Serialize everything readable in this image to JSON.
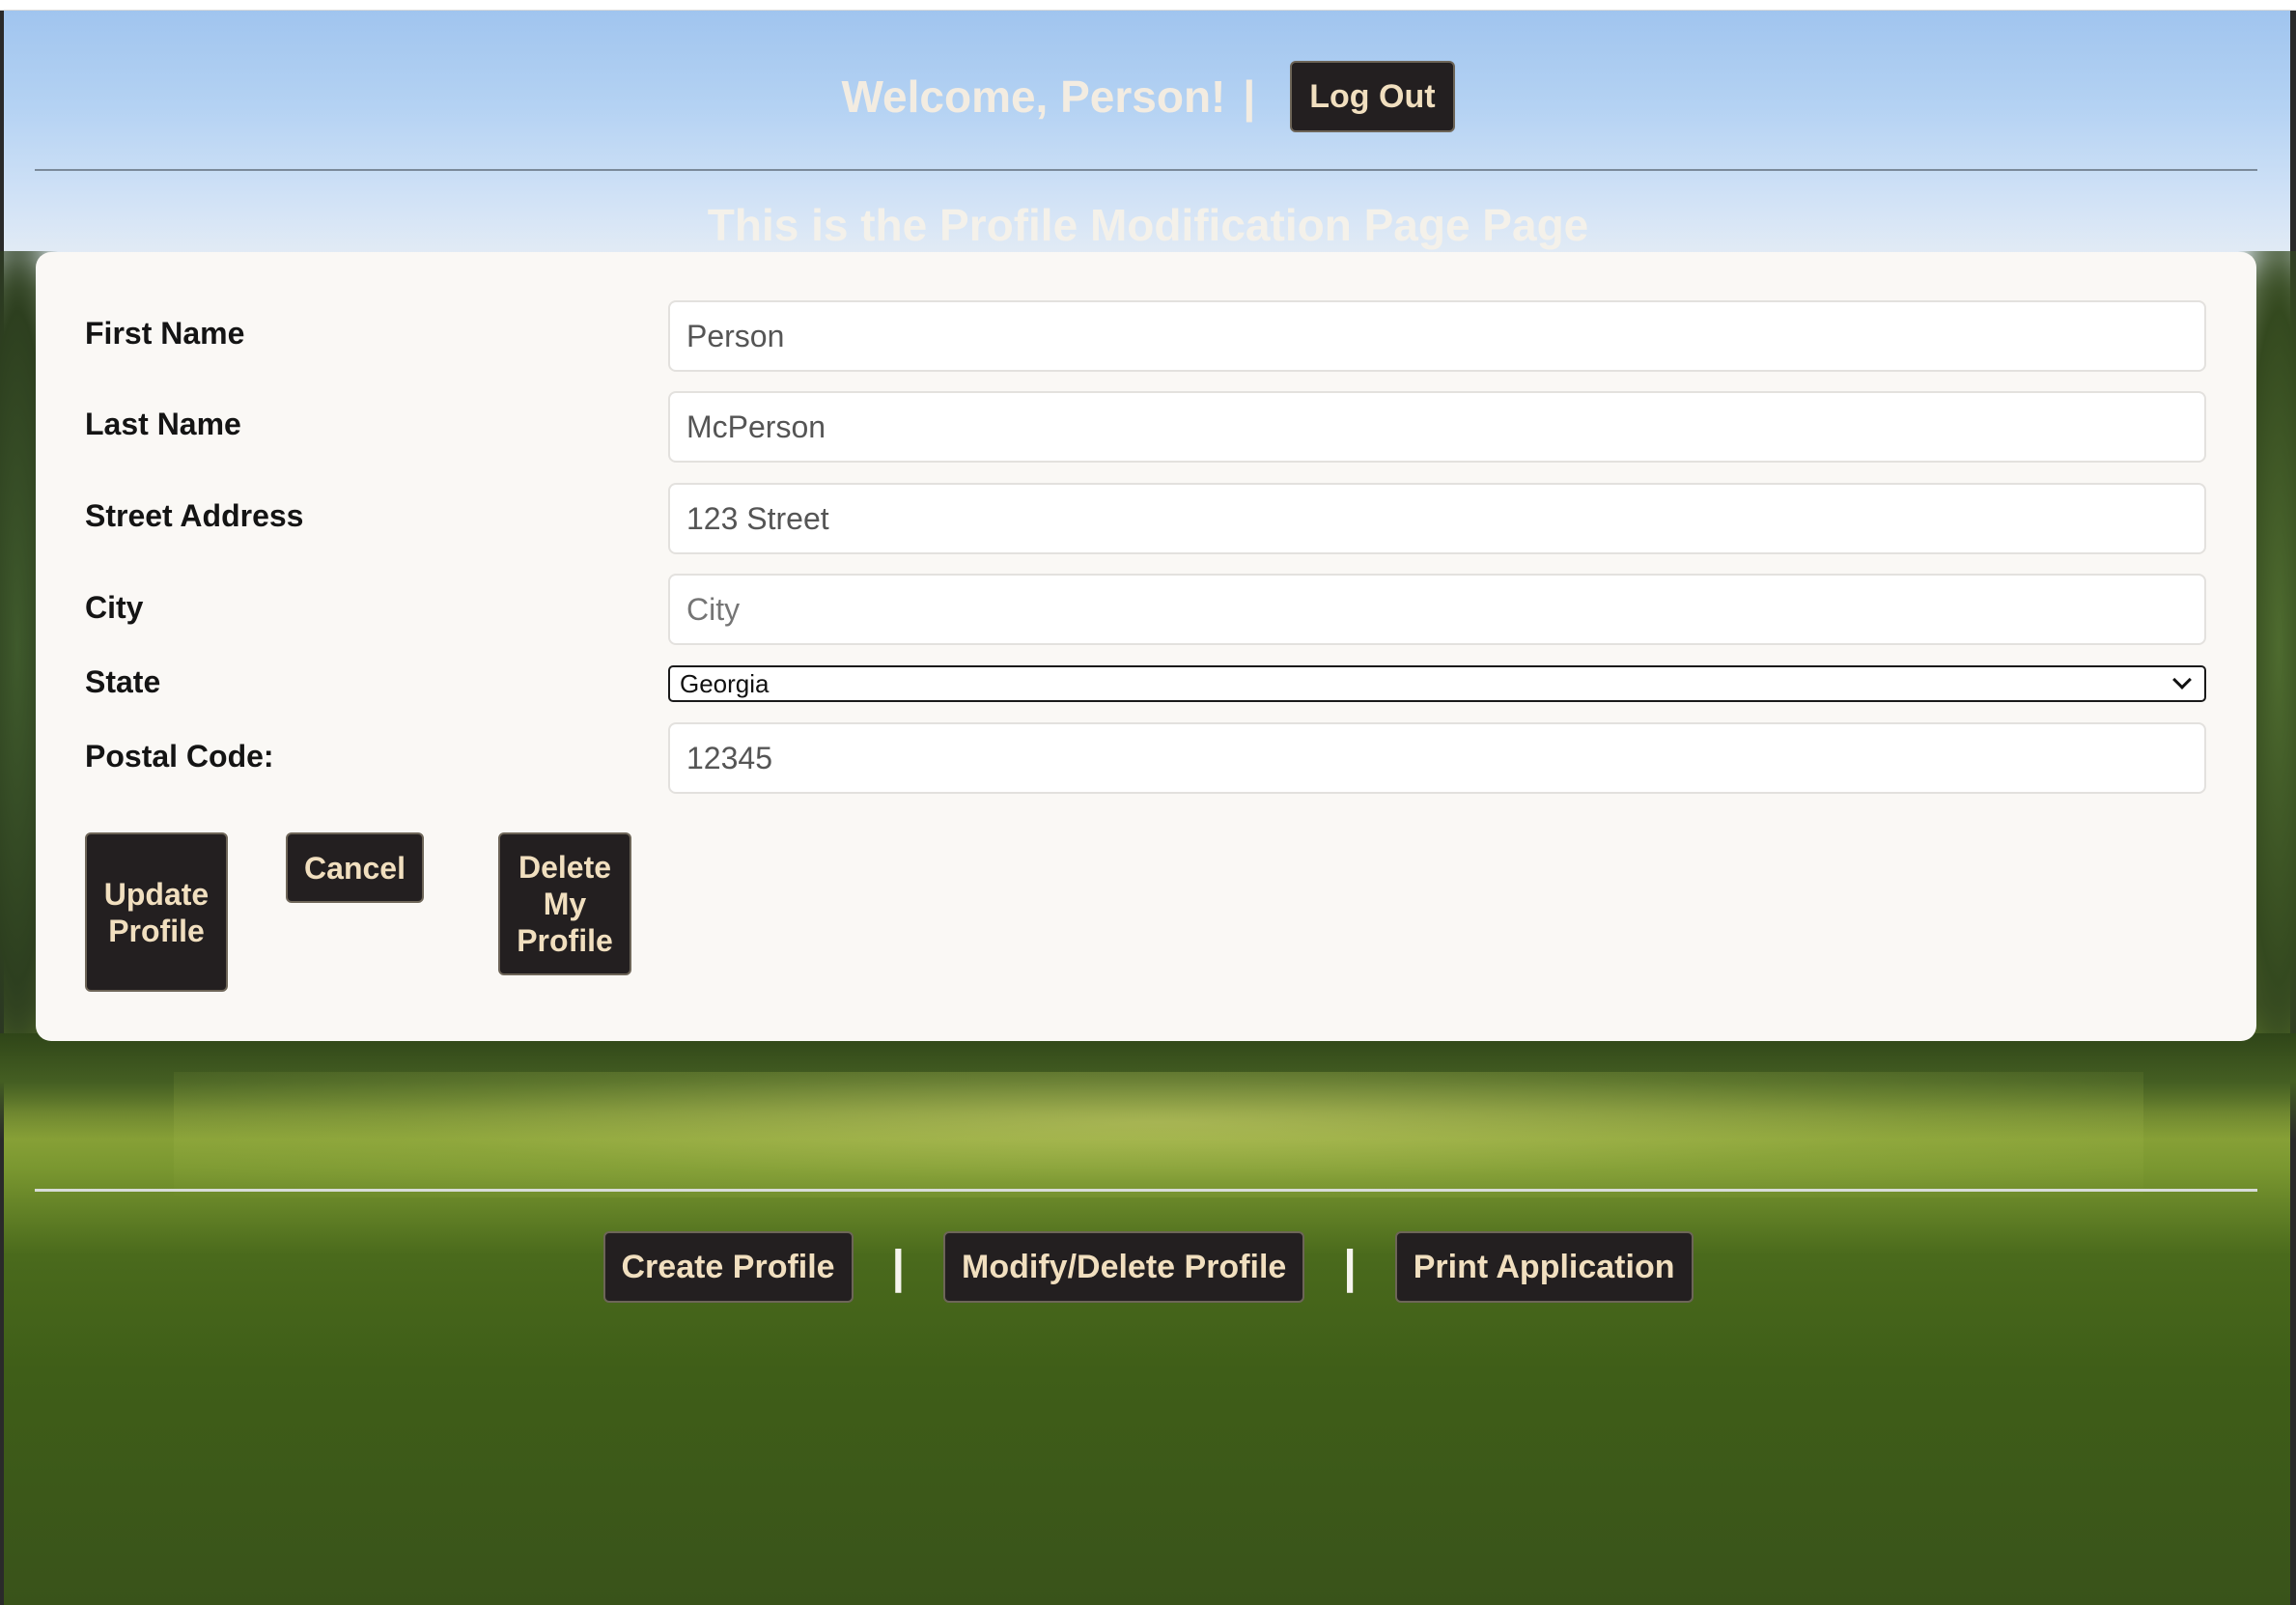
{
  "header": {
    "welcome_text": "Welcome, Person!",
    "separator": "|",
    "logout_label": "Log Out"
  },
  "page_title": "This is the Profile Modification Page Page",
  "form": {
    "first_name": {
      "label": "First Name",
      "value": "Person"
    },
    "last_name": {
      "label": "Last Name",
      "value": "McPerson"
    },
    "street_address": {
      "label": "Street Address",
      "value": "123 Street"
    },
    "city": {
      "label": "City",
      "placeholder": "City"
    },
    "state": {
      "label": "State",
      "value": "Georgia"
    },
    "postal_code": {
      "label": "Postal Code:",
      "value": "12345"
    }
  },
  "actions": {
    "update_label": "Update Profile",
    "cancel_label": "Cancel",
    "delete_label": "Delete My Profile"
  },
  "footer": {
    "items": [
      {
        "label": "Create Profile"
      },
      {
        "label": "Modify/Delete Profile"
      },
      {
        "label": "Print Application"
      }
    ],
    "separator": "|"
  },
  "colors": {
    "button_bg": "#231f20",
    "button_text": "#f1dfbf",
    "card_bg": "#faf8f5",
    "title_text": "#f4f1ea"
  }
}
